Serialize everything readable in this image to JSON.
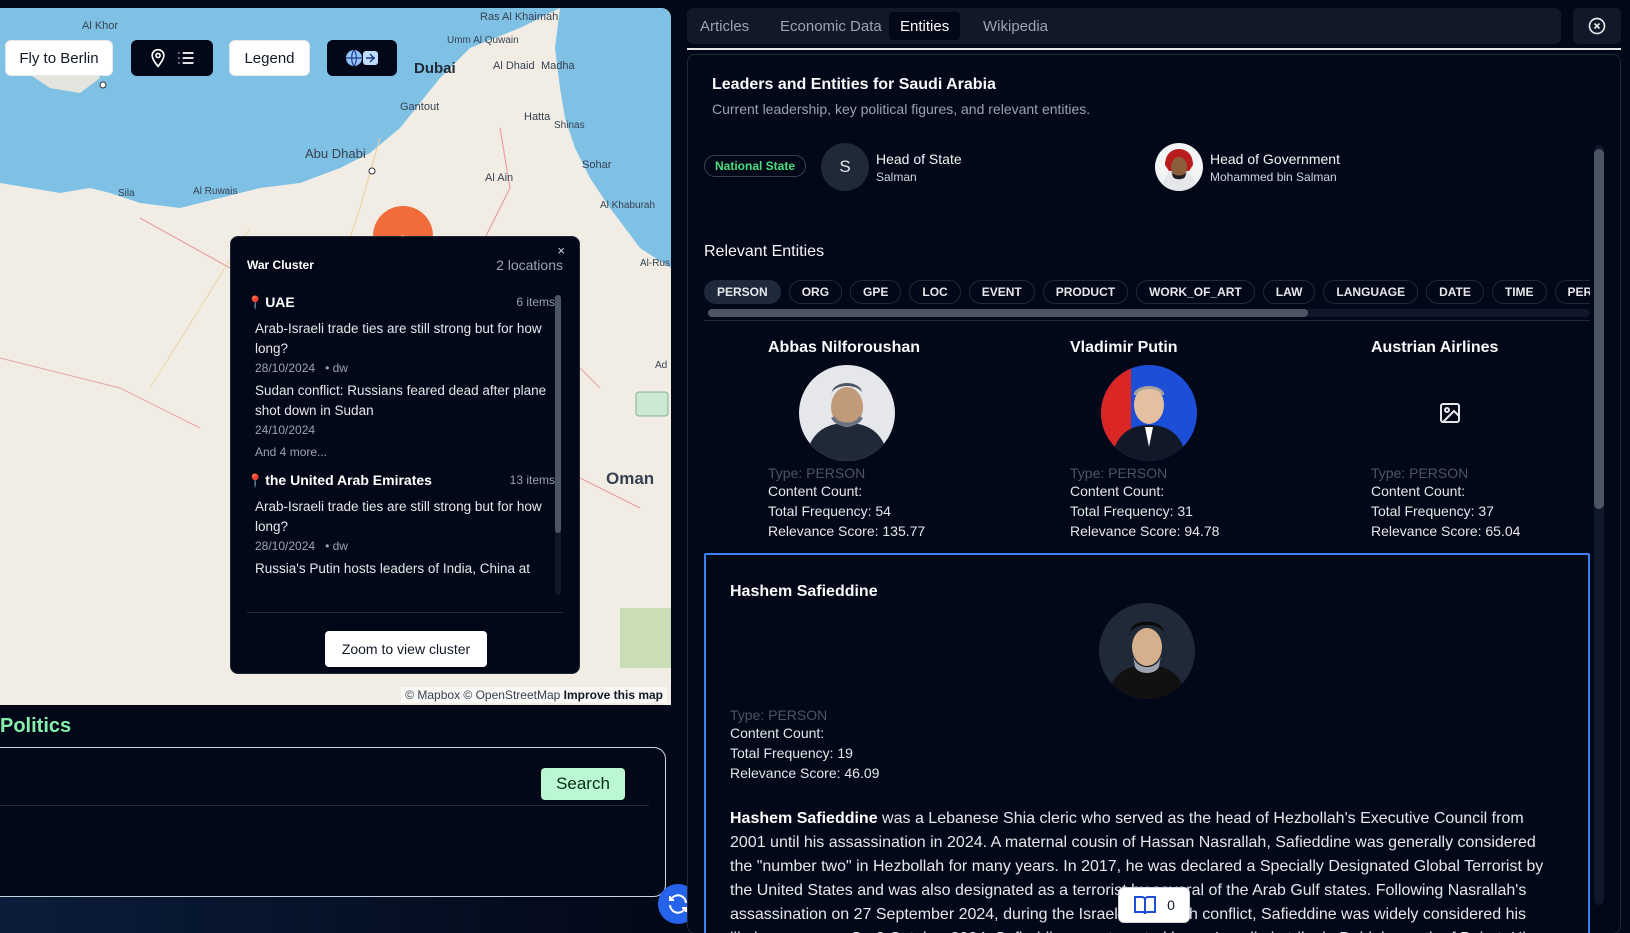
{
  "map": {
    "fly_button": "Fly to Berlin",
    "legend_button": "Legend",
    "places": {
      "al_khor": "Al Khor",
      "ras_al_khaimah": "Ras Al Khaimah",
      "umm_al_quwain": "Umm Al Quwain",
      "dubai": "Dubai",
      "al_dhaid": "Al Dhaid",
      "madha": "Madha",
      "gantout": "Gantout",
      "hatta": "Hatta",
      "shinas": "Shinas",
      "abu_dhabi": "Abu Dhabi",
      "sohar": "Sohar",
      "sila": "Sila",
      "al_ruwais": "Al Ruwais",
      "al_ain": "Al Ain",
      "al_khaburah": "Al Khaburah",
      "al_rus": "Al-Rus",
      "ad": "Ad",
      "oman": "Oman"
    },
    "attribution": "© Mapbox © OpenStreetMap",
    "improve_link": "Improve this map",
    "popup": {
      "title": "War Cluster",
      "count": "2 locations",
      "close": "×",
      "groups": [
        {
          "location": "UAE",
          "items_count": "6 items",
          "items": [
            {
              "title": "Arab-Israeli trade ties are still strong but for how long?",
              "date": "28/10/2024",
              "source": "• dw"
            },
            {
              "title": "Sudan conflict: Russians feared dead after plane shot down in Sudan",
              "date": "24/10/2024",
              "source": ""
            }
          ],
          "more": "And 4 more..."
        },
        {
          "location": "the United Arab Emirates",
          "items_count": "13 items",
          "items": [
            {
              "title": "Arab-Israeli trade ties are still strong but for how long?",
              "date": "28/10/2024",
              "source": "• dw"
            },
            {
              "title": "Russia's Putin hosts leaders of India, China at",
              "date": "",
              "source": ""
            }
          ]
        }
      ],
      "zoom_button": "Zoom to view cluster"
    }
  },
  "left": {
    "section_title": "Politics",
    "search_button": "Search"
  },
  "tabs": [
    "Articles",
    "Economic Data",
    "Entities",
    "Wikipedia"
  ],
  "active_tab": "Entities",
  "panel": {
    "title": "Leaders and Entities for Saudi Arabia",
    "subtitle": "Current leadership, key political figures, and relevant entities.",
    "state_badge": "National State",
    "head_of_state": {
      "role": "Head of State",
      "name": "Salman",
      "initial": "S"
    },
    "head_of_government": {
      "role": "Head of Government",
      "name": "Mohammed bin Salman"
    },
    "relevant_heading": "Relevant Entities",
    "entity_types": [
      "PERSON",
      "ORG",
      "GPE",
      "LOC",
      "EVENT",
      "PRODUCT",
      "WORK_OF_ART",
      "LAW",
      "LANGUAGE",
      "DATE",
      "TIME",
      "PERCENT"
    ],
    "active_type": "PERSON",
    "entities": [
      {
        "name": "Abbas Nilforoushan",
        "type": "Type: PERSON",
        "content": "Content Count:",
        "freq": "Total Frequency: 54",
        "score": "Relevance Score: 135.77"
      },
      {
        "name": "Vladimir Putin",
        "type": "Type: PERSON",
        "content": "Content Count:",
        "freq": "Total Frequency: 31",
        "score": "Relevance Score: 94.78"
      },
      {
        "name": "Austrian Airlines",
        "type": "Type: PERSON",
        "content": "Content Count:",
        "freq": "Total Frequency: 37",
        "score": "Relevance Score: 65.04"
      }
    ],
    "selected": {
      "name": "Hashem Safieddine",
      "type": "Type: PERSON",
      "content": "Content Count:",
      "freq": "Total Frequency: 19",
      "score": "Relevance Score: 46.09",
      "bio_name": "Hashem Safieddine",
      "bio_text": " was a Lebanese Shia cleric who served as the head of Hezbollah's Executive Council from 2001 until his assassination in 2024. A maternal cousin of Hassan Nasrallah, Safieddine was generally considered the \"number two\" in Hezbollah for many years. In 2017, he was declared a Specially Designated Global Terrorist by the United States and was also designated as a terrorist by several of the Arab Gulf states. Following Nasrallah's assassination on 27 September 2024, during the Israel–Hezbollah conflict, Safieddine was widely considered his likely successor. On 3 October 2024, Safieddine was targeted by an Israeli airstrike in Dahieh, south of Beirut. His"
    }
  },
  "reading_count": "0",
  "colors": {
    "accent": "#3b82f6",
    "badge_green": "#4ade80",
    "search_green": "#bbf7d0",
    "background": "#020817"
  }
}
